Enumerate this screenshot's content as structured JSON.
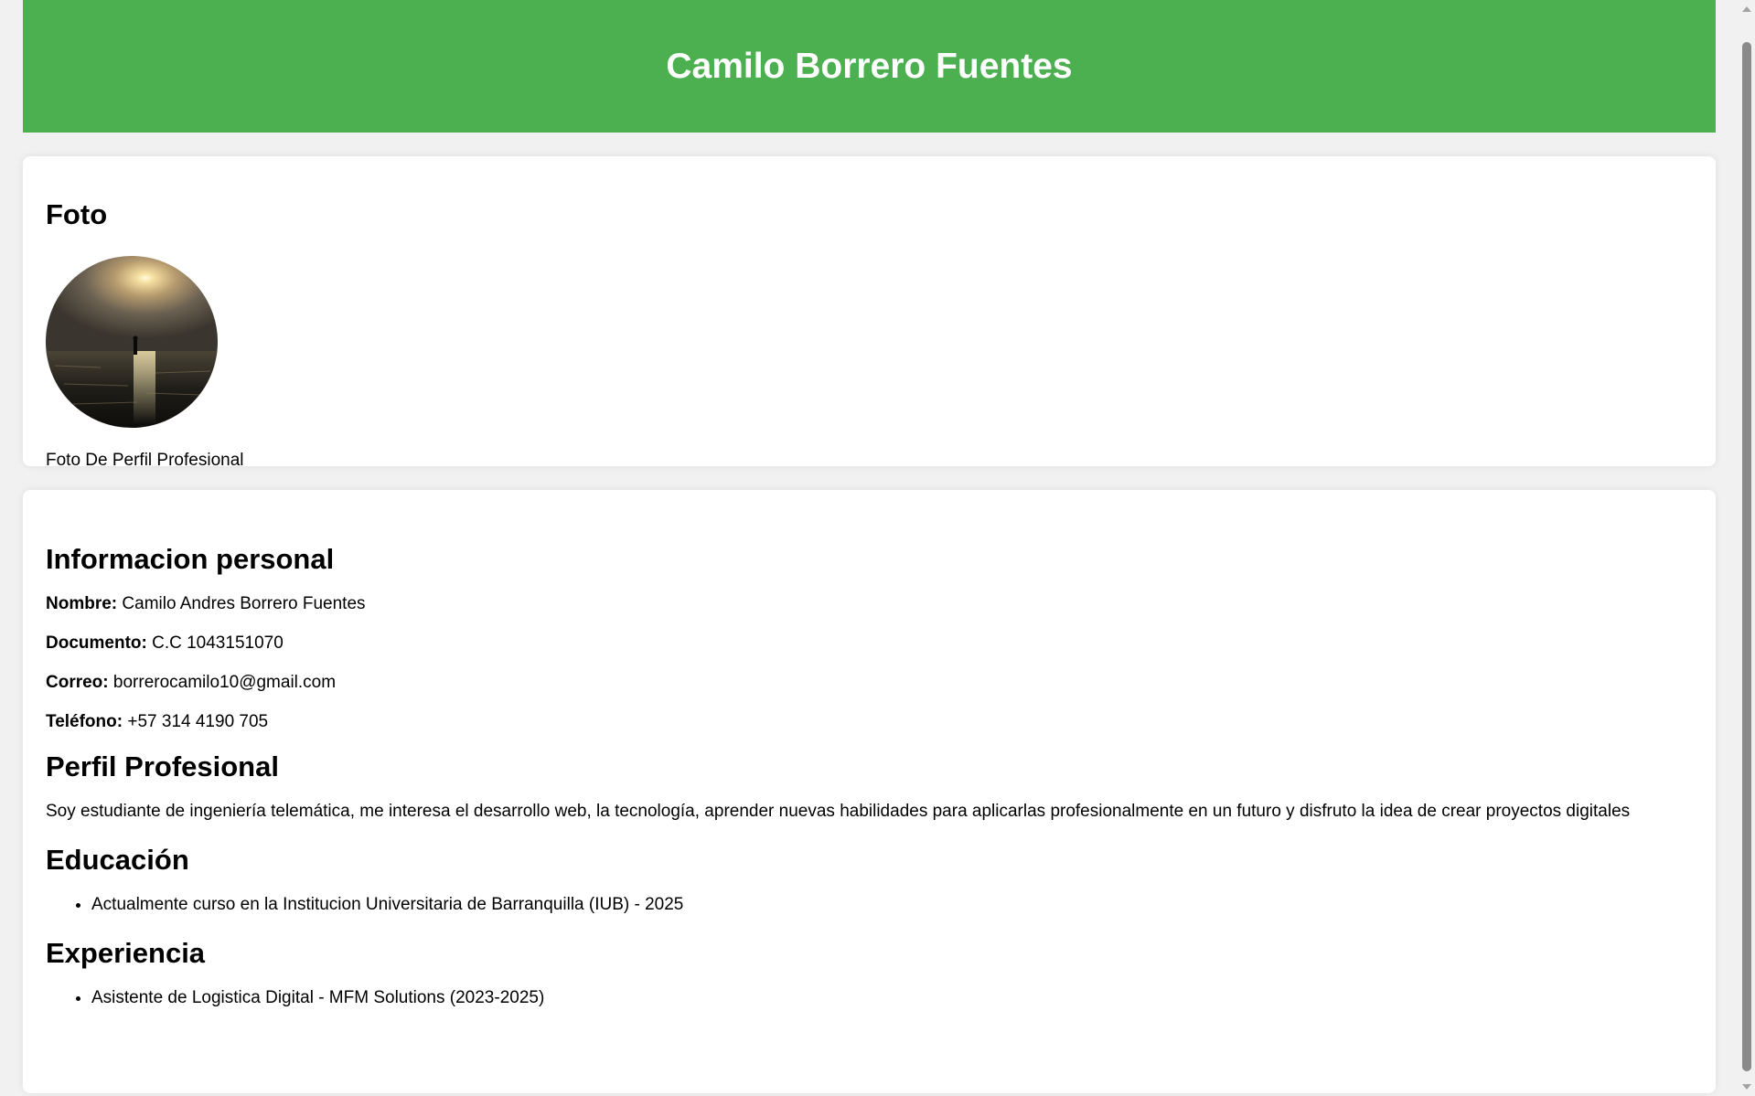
{
  "header": {
    "title": "Camilo Borrero Fuentes"
  },
  "photo_section": {
    "title": "Foto",
    "caption": "Foto De Perfil Profesional"
  },
  "personal_info": {
    "title": "Informacion personal",
    "rows": [
      {
        "label": "Nombre:",
        "value": "Camilo Andres Borrero Fuentes"
      },
      {
        "label": "Documento:",
        "value": "C.C 1043151070"
      },
      {
        "label": "Correo:",
        "value": "borrerocamilo10@gmail.com"
      },
      {
        "label": "Teléfono:",
        "value": "+57 314 4190 705"
      }
    ]
  },
  "profile": {
    "title": "Perfil Profesional",
    "text": "Soy estudiante de ingeniería telemática, me interesa el desarrollo web, la tecnología, aprender nuevas habilidades para aplicarlas profesionalmente en un futuro y disfruto la idea de crear proyectos digitales"
  },
  "education": {
    "title": "Educación",
    "items": [
      "Actualmente curso en la Institucion Universitaria de Barranquilla (IUB) - 2025"
    ]
  },
  "experience": {
    "title": "Experiencia",
    "items": [
      "Asistente de Logistica Digital - MFM Solutions (2023-2025)"
    ]
  },
  "colors": {
    "header_bg": "#4caf50",
    "page_bg": "#f1f1f1",
    "card_bg": "#ffffff"
  }
}
